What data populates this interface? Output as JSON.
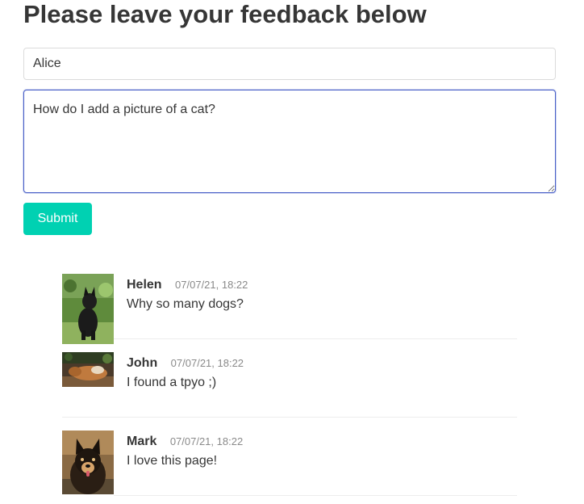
{
  "heading": "Please leave your feedback below",
  "form": {
    "name_value": "Alice",
    "message_value": "How do I add a picture of a cat?",
    "submit_label": "Submit"
  },
  "colors": {
    "primary_button": "#00d1b2",
    "focus_border": "#485fc7"
  },
  "comments": [
    {
      "author": "Helen",
      "timestamp": "07/07/21, 18:22",
      "text": "Why so many dogs?",
      "avatar": "black-dog-on-grass-photo"
    },
    {
      "author": "John",
      "timestamp": "07/07/21, 18:22",
      "text": "I found a tpyo ;)",
      "avatar": "sleeping-dog-photo"
    },
    {
      "author": "Mark",
      "timestamp": "07/07/21, 18:22",
      "text": "I love this page!",
      "avatar": "fluffy-dog-portrait-photo"
    }
  ]
}
